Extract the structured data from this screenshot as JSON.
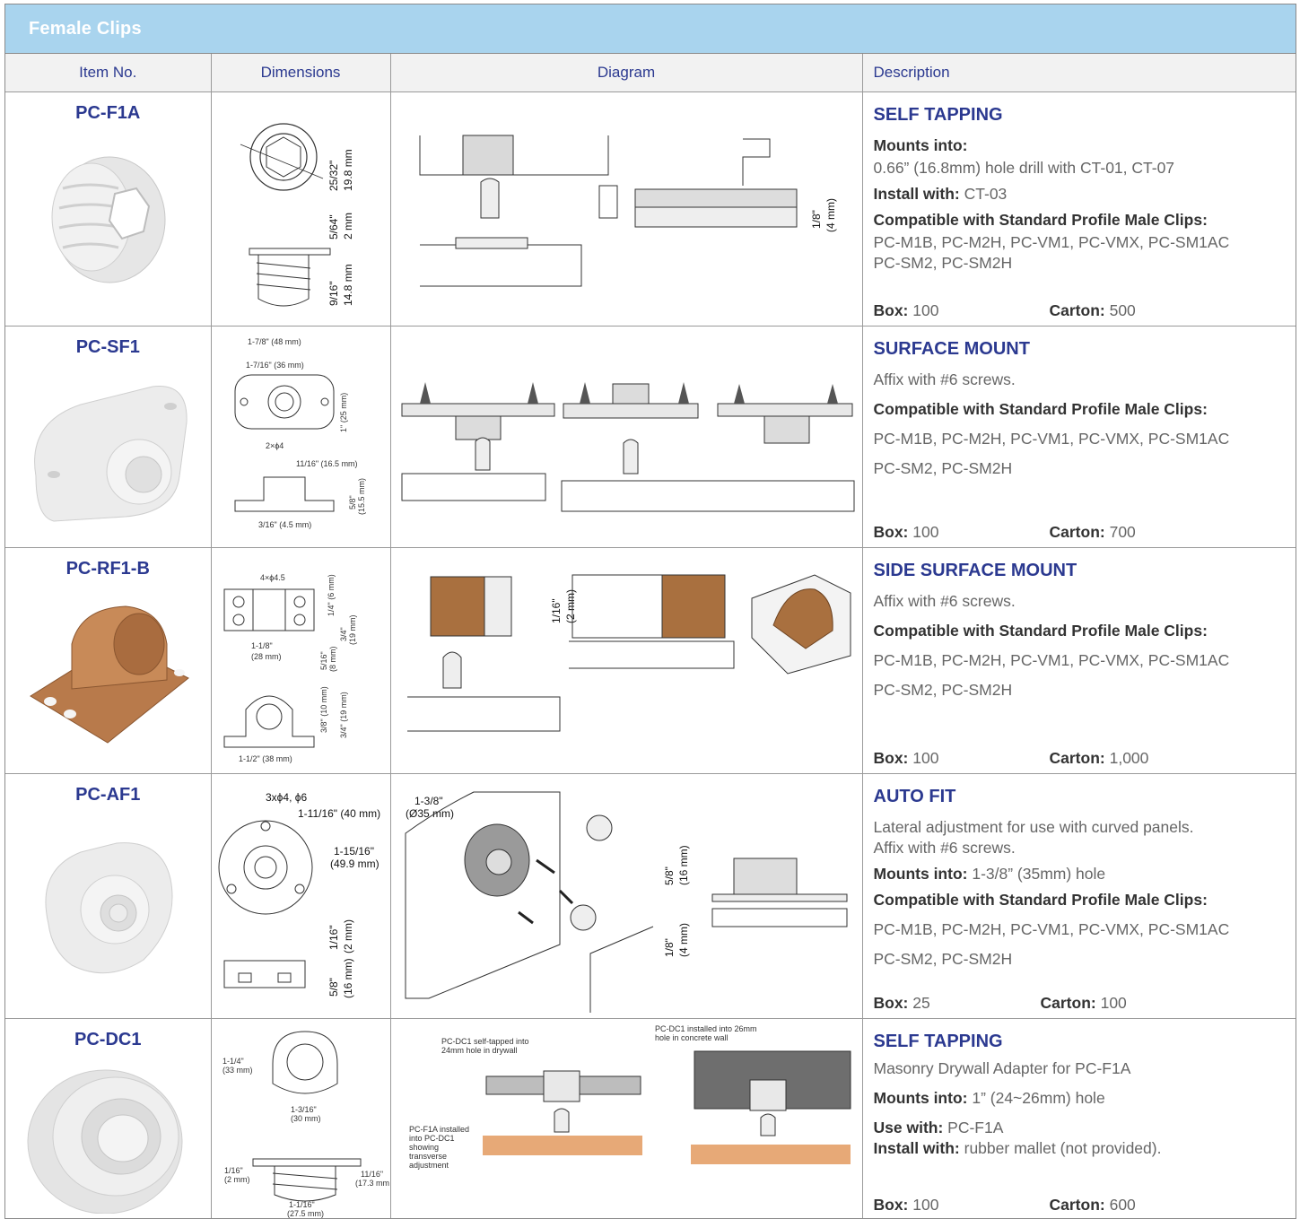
{
  "title": "Female Clips",
  "headers": {
    "item": "Item No.",
    "dimensions": "Dimensions",
    "diagram": "Diagram",
    "description": "Description"
  },
  "labels": {
    "box": "Box:",
    "carton": "Carton:"
  },
  "rows": [
    {
      "item": "PC-F1A",
      "title": "SELF TAPPING",
      "lines": [
        {
          "label": "Mounts into:",
          "text": ""
        },
        {
          "label": "",
          "text": "0.66” (16.8mm) hole drill with CT-01, CT-07"
        },
        {
          "label": "Install with:",
          "text": "CT-03"
        },
        {
          "label": "Compatible with Standard Profile Male Clips:",
          "text": ""
        },
        {
          "label": "",
          "text": "PC-M1B, PC-M2H, PC-VM1, PC-VMX, PC-SM1AC"
        },
        {
          "label": "",
          "text": "PC-SM2, PC-SM2H"
        }
      ],
      "box": "100",
      "carton": "500",
      "dims": [
        "25/32\"",
        "19.8 mm",
        "5/64\"",
        "2 mm",
        "9/16\"",
        "14.8 mm"
      ],
      "diag": [
        "1/8\"",
        "(4 mm)"
      ]
    },
    {
      "item": "PC-SF1",
      "title": "SURFACE MOUNT",
      "lines": [
        {
          "label": "",
          "text": "Affix with #6 screws."
        },
        {
          "label": "Compatible with Standard Profile Male Clips:",
          "text": ""
        },
        {
          "label": "",
          "text": "PC-M1B, PC-M2H, PC-VM1, PC-VMX, PC-SM1AC"
        },
        {
          "label": "",
          "text": "PC-SM2, PC-SM2H"
        }
      ],
      "box": "100",
      "carton": "700",
      "dims": [
        "1-7/8\" (48 mm)",
        "1-7/16\" (36 mm)",
        "1\" (25 mm)",
        "2×ϕ4",
        "11/16\" (16.5 mm)",
        "5/8\"",
        "(15.5 mm)",
        "3/16\" (4.5 mm)"
      ],
      "diag": []
    },
    {
      "item": "PC-RF1-B",
      "title": "SIDE SURFACE MOUNT",
      "lines": [
        {
          "label": "",
          "text": "Affix with #6 screws."
        },
        {
          "label": "Compatible with Standard Profile Male Clips:",
          "text": ""
        },
        {
          "label": "",
          "text": "PC-M1B, PC-M2H, PC-VM1, PC-VMX, PC-SM1AC"
        },
        {
          "label": "",
          "text": "PC-SM2, PC-SM2H"
        }
      ],
      "box": "100",
      "carton": "1,000",
      "dims": [
        "4×ϕ4.5",
        "1/4\" (6 mm)",
        "3/4\"",
        "(19 mm)",
        "1-1/8\"",
        "(28 mm)",
        "5/16\"",
        "(8 mm)",
        "3/8\" (10 mm)",
        "3/4\" (19 mm)",
        "1-1/2\" (38 mm)"
      ],
      "diag": [
        "1/16\"",
        "(2 mm)"
      ]
    },
    {
      "item": "PC-AF1",
      "title": "AUTO FIT",
      "lines": [
        {
          "label": "",
          "text": "Lateral adjustment for use with curved panels."
        },
        {
          "label": "",
          "text": "Affix with #6 screws."
        },
        {
          "label": "Mounts into:",
          "text": "1-3/8” (35mm) hole"
        },
        {
          "label": "Compatible with Standard Profile Male Clips:",
          "text": ""
        },
        {
          "label": "",
          "text": "PC-M1B, PC-M2H, PC-VM1, PC-VMX,  PC-SM1AC"
        },
        {
          "label": "",
          "text": "PC-SM2, PC-SM2H"
        }
      ],
      "box": "25",
      "carton": "100",
      "dims": [
        "3xϕ4, ϕ6",
        "1-11/16\" (40 mm)",
        "1-15/16\"",
        "(49.9 mm)",
        "1/16\"",
        "(2 mm)",
        "5/8\"",
        "(16 mm)"
      ],
      "diag": [
        "1-3/8\"",
        "(Ø35 mm)",
        "5/8\"",
        "(16 mm)",
        "1/8\"",
        "(4 mm)"
      ]
    },
    {
      "item": "PC-DC1",
      "title": "SELF TAPPING",
      "lines": [
        {
          "label": "",
          "text": "Masonry Drywall Adapter for PC-F1A"
        },
        {
          "label": "Mounts into:",
          "text": "1” (24~26mm) hole"
        },
        {
          "label": "Use with:",
          "text": "PC-F1A"
        },
        {
          "label": "Install with:",
          "text": "rubber mallet (not provided)."
        }
      ],
      "box": "100",
      "carton": "600",
      "dims": [
        "1-1/4\"",
        "(33 mm)",
        "1-3/16\"",
        "(30 mm)",
        "1/16\"",
        "(2 mm)",
        "11/16\"",
        "(17.3 mm)",
        "1-1/16\"",
        "(27.5 mm)"
      ],
      "diag": [
        "PC-DC1 self-tapped into",
        "24mm hole in drywall",
        "PC-DC1 installed into 26mm",
        "hole in concrete wall",
        "PC-F1A installed",
        "into PC-DC1",
        "showing",
        "transverse",
        "adjustment"
      ]
    }
  ],
  "colors": {
    "header_bar": "#a9d4ee",
    "brand_blue": "#2b3990",
    "copper": "#b87a4b"
  }
}
